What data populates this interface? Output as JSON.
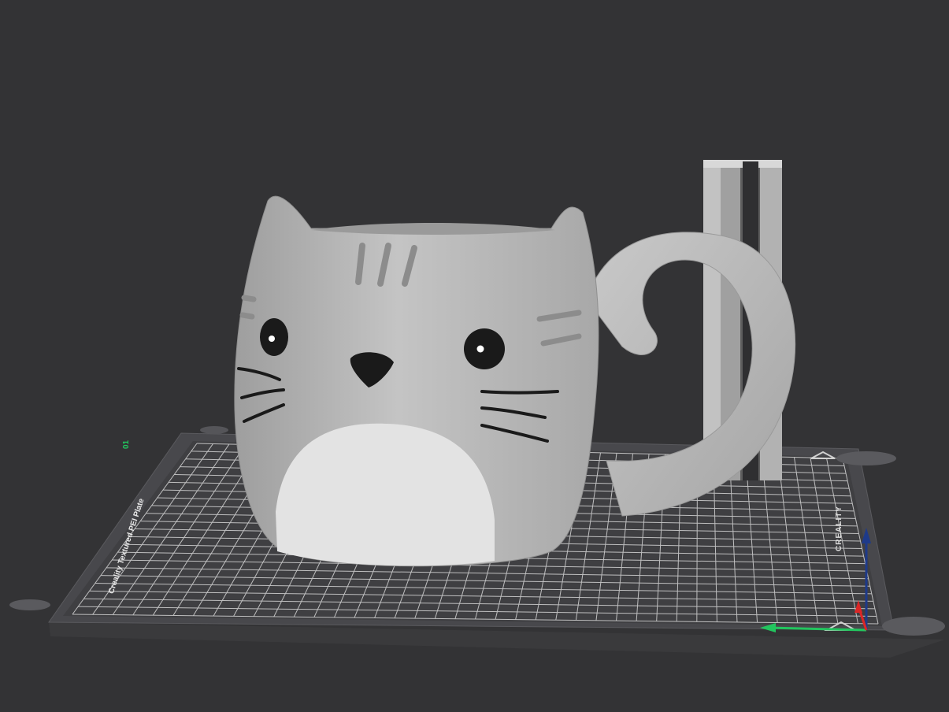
{
  "viewport": {
    "plate_label": "Creality Textured PEI Plate",
    "brand_label": "CREALITY",
    "plate_number": "01"
  },
  "colors": {
    "background": "#333335",
    "plate": "#4a4a4e",
    "grid": "#d8d8d8",
    "model": "#b9b9b9",
    "axis_x": "#22c55e",
    "axis_y": "#1e3a8a",
    "axis_z": "#dc2626"
  },
  "icons": [
    "mug-model",
    "prime-tower",
    "build-plate",
    "axis-gizmo"
  ]
}
